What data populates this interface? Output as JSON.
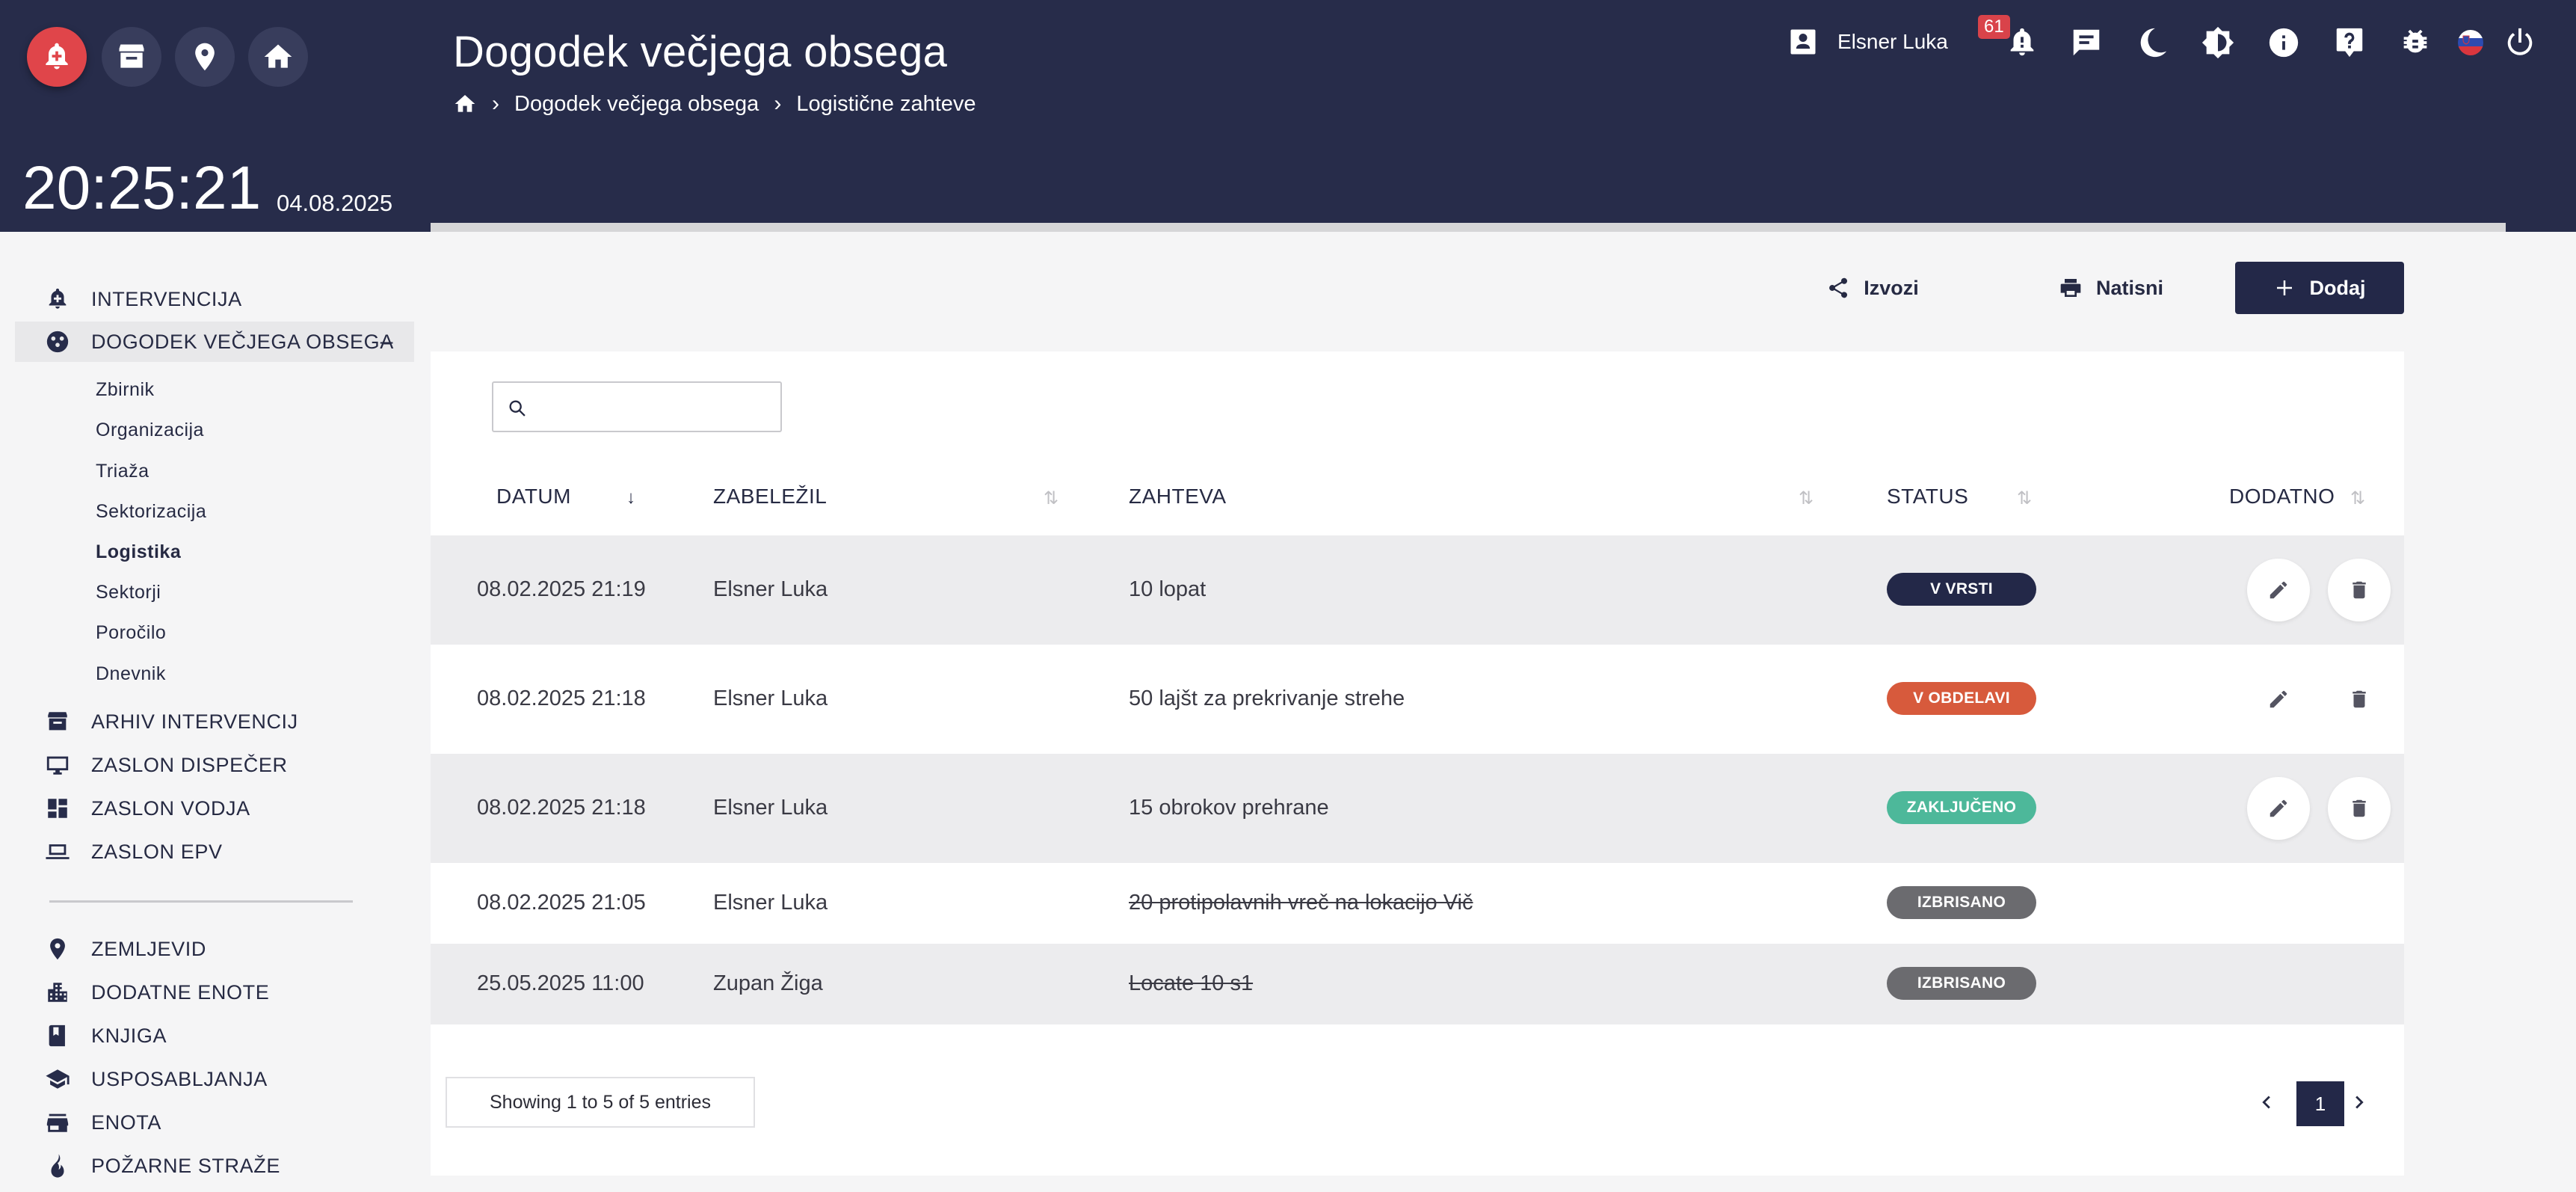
{
  "header": {
    "title": "Dogodek večjega obsega",
    "breadcrumb": [
      "Dogodek večjega obsega",
      "Logistične zahteve"
    ],
    "clock": "20:25:21",
    "date": "04.08.2025",
    "user": "Elsner Luka",
    "notification_count": "61",
    "icons": [
      "alarm-add-icon",
      "archive-icon",
      "location-pin-icon",
      "home-icon",
      "user-card-icon",
      "notification-alert-icon",
      "chat-icon",
      "moon-icon",
      "brightness-icon",
      "info-icon",
      "help-icon",
      "bug-icon",
      "flag-slovenia-icon",
      "power-icon"
    ]
  },
  "sidebar": {
    "items_top": [
      {
        "label": "INTERVENCIJA",
        "icon": "alarm-bell-icon"
      },
      {
        "label": "DOGODEK VEČJEGA OBSEGA",
        "icon": "biohazard-icon",
        "expanded_marker": "–"
      }
    ],
    "sub_items": [
      {
        "label": "Zbirnik"
      },
      {
        "label": "Organizacija"
      },
      {
        "label": "Triaža"
      },
      {
        "label": "Sektorizacija"
      },
      {
        "label": "Logistika"
      },
      {
        "label": "Sektorji"
      },
      {
        "label": "Poročilo"
      },
      {
        "label": "Dnevnik"
      }
    ],
    "items_mid": [
      {
        "label": "ARHIV INTERVENCIJ",
        "icon": "archive-icon"
      },
      {
        "label": "ZASLON DISPEČER",
        "icon": "monitor-icon"
      },
      {
        "label": "ZASLON VODJA",
        "icon": "dashboard-icon"
      },
      {
        "label": "ZASLON EPV",
        "icon": "laptop-icon"
      }
    ],
    "items_bottom": [
      {
        "label": "ZEMLJEVID",
        "icon": "location-pin-icon"
      },
      {
        "label": "DODATNE ENOTE",
        "icon": "city-icon"
      },
      {
        "label": "KNJIGA",
        "icon": "book-icon"
      },
      {
        "label": "USPOSABLJANJA",
        "icon": "school-icon"
      },
      {
        "label": "ENOTA",
        "icon": "store-icon"
      },
      {
        "label": "POŽARNE STRAŽE",
        "icon": "fire-icon"
      }
    ]
  },
  "actions": {
    "export": "Izvozi",
    "print": "Natisni",
    "add": "Dodaj"
  },
  "search": {
    "placeholder": ""
  },
  "table": {
    "columns": [
      "DATUM",
      "ZABELEŽIL",
      "ZAHTEVA",
      "STATUS",
      "DODATNO"
    ],
    "rows": [
      {
        "datum": "08.02.2025 21:19",
        "zabelezil": "Elsner Luka",
        "zahteva": "10 lopat",
        "status": "V VRSTI",
        "status_color": "#232848",
        "struck": false,
        "actions": true
      },
      {
        "datum": "08.02.2025 21:18",
        "zabelezil": "Elsner Luka",
        "zahteva": "50 lajšt za prekrivanje strehe",
        "status": "V OBDELAVI",
        "status_color": "#d75a3c",
        "struck": false,
        "actions": true
      },
      {
        "datum": "08.02.2025 21:18",
        "zabelezil": "Elsner Luka",
        "zahteva": "15 obrokov prehrane",
        "status": "ZAKLJUČENO",
        "status_color": "#4db89a",
        "struck": false,
        "actions": true
      },
      {
        "datum": "08.02.2025 21:05",
        "zabelezil": "Elsner Luka",
        "zahteva": "20 protipolavnih vreč na lokacijo Vič",
        "status": "IZBRISANO",
        "status_color": "#6b6b6f",
        "struck": true,
        "actions": false
      },
      {
        "datum": "25.05.2025 11:00",
        "zabelezil": "Zupan Žiga",
        "zahteva": "Locate 10 s1",
        "status": "IZBRISANO",
        "status_color": "#6b6b6f",
        "struck": true,
        "actions": false
      }
    ]
  },
  "pagination": {
    "info": "Showing 1 to 5 of 5 entries",
    "current_page": "1"
  }
}
